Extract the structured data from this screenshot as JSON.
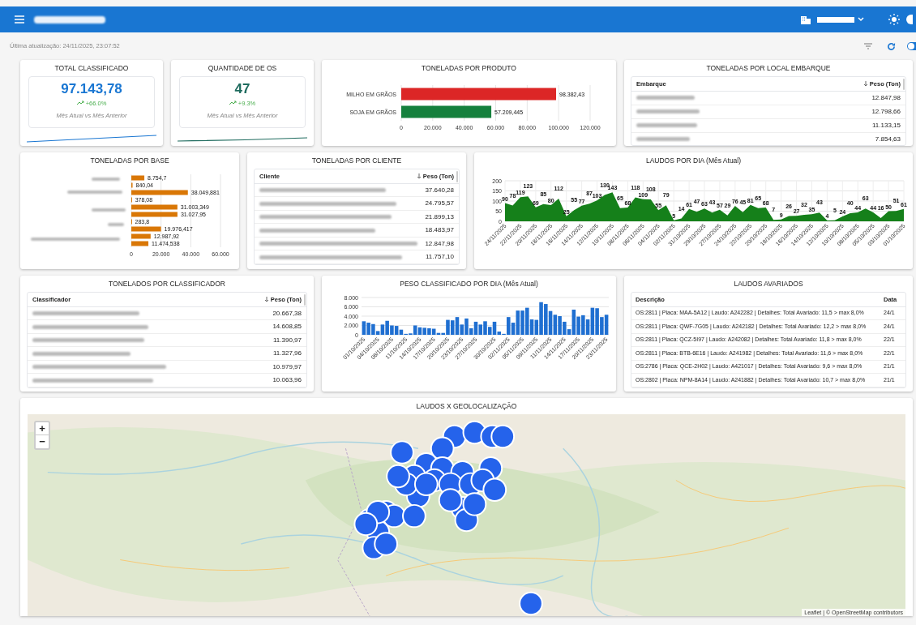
{
  "status": {
    "last_update": "Última atualização: 24/11/2025, 23:07:52",
    "auto_refresh_on": true
  },
  "kpis": [
    {
      "title": "TOTAL CLASSIFICADO",
      "value": "97.143,78",
      "change": "+66.0%",
      "caption": "Mês Atual vs Mês Anterior",
      "color": "#1976d2"
    },
    {
      "title": "QUANTIDADE DE OS",
      "value": "47",
      "change": "+9.3%",
      "caption": "Mês Atual vs Mês Anterior",
      "color": "#1e6b5e"
    }
  ],
  "produto": {
    "title": "TONELADAS POR PRODUTO",
    "chart_data": {
      "type": "bar",
      "orientation": "horizontal",
      "stacked": true,
      "grid": true,
      "categories": [
        "MILHO EM GRÃOS",
        "SOJA EM GRÃOS"
      ],
      "series": [
        {
          "color": "#dc2626",
          "values": [
            98382.43,
            null
          ]
        },
        {
          "color": "#15803d",
          "values": [
            null,
            57209.445
          ]
        }
      ],
      "value_labels": [
        "98.382,43",
        "57.209,445"
      ],
      "xlim": [
        0,
        120000
      ],
      "xticks": [
        {
          "value": 0,
          "label": "0"
        },
        {
          "value": 20000,
          "label": "20.000"
        },
        {
          "value": 40000,
          "label": "40.000"
        },
        {
          "value": 60000,
          "label": "60.000"
        },
        {
          "value": 80000,
          "label": "80.000"
        },
        {
          "value": 100000,
          "label": "100.000"
        },
        {
          "value": 120000,
          "label": "120.000"
        }
      ]
    }
  },
  "embarque": {
    "title": "TONELADAS POR LOCAL EMBARQUE",
    "columns": [
      "Embarque",
      "Peso (Ton)"
    ],
    "rows": [
      "12.847,98",
      "12.798,66",
      "11.133,15",
      "7.854,63"
    ]
  },
  "base": {
    "title": "TONELADAS POR BASE",
    "chart_data": {
      "type": "bar",
      "orientation": "horizontal",
      "grid": true,
      "series": [
        {
          "color": "#d97706",
          "values": [
            8754.7,
            840.04,
            38049.881,
            378.08,
            31003.349,
            31027.95,
            283.8,
            19976.417,
            12987.92,
            11474.538
          ]
        }
      ],
      "value_labels": [
        "8.754,7",
        "840,04",
        "38.049,881",
        "378,08",
        "31.003,349",
        "31.027,95",
        "283,8",
        "19.976,417",
        "12.987,92",
        "11.474,538"
      ],
      "xlim": [
        0,
        60000
      ],
      "xticks": [
        {
          "value": 0,
          "label": "0"
        },
        {
          "value": 20000,
          "label": "20.000"
        },
        {
          "value": 40000,
          "label": "40.000"
        },
        {
          "value": 60000,
          "label": "60.000"
        }
      ]
    }
  },
  "cliente": {
    "title": "TONELADAS POR CLIENTE",
    "columns": [
      "Cliente",
      "Peso (Ton)"
    ],
    "rows": [
      "37.640,28",
      "24.795,57",
      "21.899,13",
      "18.483,97",
      "12.847,98",
      "11.757,10"
    ]
  },
  "laudos_dia": {
    "title": "LAUDOS POR DIA (Mês Atual)",
    "chart_data": {
      "type": "area",
      "data_labels": true,
      "grid": true,
      "ylim": [
        0,
        200
      ],
      "yticks": [
        0,
        50,
        100,
        150,
        200
      ],
      "categories": [
        "24/11/2025",
        null,
        "22/11/2025",
        null,
        "20/11/2025",
        null,
        "18/11/2025",
        null,
        "16/11/2025",
        null,
        "14/11/2025",
        null,
        "12/11/2025",
        null,
        "10/11/2025",
        null,
        "08/11/2025",
        null,
        "06/11/2025",
        null,
        "04/11/2025",
        null,
        "02/11/2025",
        null,
        "31/10/2025",
        null,
        "29/10/2025",
        null,
        "27/10/2025",
        null,
        "24/10/2025",
        null,
        "22/10/2025",
        null,
        "20/10/2025",
        null,
        "18/10/2025",
        null,
        "16/10/2025",
        null,
        "14/10/2025",
        null,
        "12/10/2025",
        null,
        "10/10/2025",
        null,
        "08/10/2025",
        null,
        "05/10/2025",
        null,
        "03/10/2025",
        null,
        "01/10/2025"
      ],
      "series": [
        {
          "color": "#15801a",
          "values": [
            90,
            78,
            119,
            123,
            69,
            85,
            80,
            112,
            25,
            55,
            77,
            87,
            103,
            130,
            143,
            65,
            68,
            118,
            109,
            108,
            55,
            79,
            5,
            14,
            61,
            47,
            63,
            43,
            57,
            29,
            76,
            45,
            81,
            65,
            68,
            7,
            9,
            26,
            27,
            32,
            35,
            43,
            4,
            5,
            24,
            40,
            44,
            63,
            44,
            16,
            50,
            51,
            61
          ]
        }
      ]
    }
  },
  "classificador": {
    "title": "TONELADOS POR CLASSIFICADOR",
    "columns": [
      "Classificador",
      "Peso (Ton)"
    ],
    "rows": [
      "20.667,38",
      "14.608,85",
      "11.390,97",
      "11.327,96",
      "10.979,97",
      "10.063,96"
    ]
  },
  "peso_dia": {
    "title": "PESO CLASSIFICADO POR DIA (Mês Atual)",
    "chart_data": {
      "type": "bar",
      "grid": true,
      "ylim": [
        0,
        8000
      ],
      "yticks": [
        {
          "value": 0,
          "label": "0"
        },
        {
          "value": 2000,
          "label": "2.000"
        },
        {
          "value": 4000,
          "label": "4.000"
        },
        {
          "value": 6000,
          "label": "6.000"
        },
        {
          "value": 8000,
          "label": "8.000"
        }
      ],
      "categories": [
        "01/10/2025",
        null,
        null,
        "04/10/2025",
        null,
        null,
        "08/10/2025",
        null,
        null,
        "11/10/2025",
        null,
        null,
        "14/10/2025",
        null,
        null,
        "17/10/2025",
        null,
        null,
        "20/10/2025",
        null,
        null,
        "23/10/2025",
        null,
        null,
        "27/10/2025",
        null,
        null,
        null,
        "30/10/2025",
        null,
        null,
        "02/11/2025",
        null,
        null,
        "05/11/2025",
        null,
        null,
        "09/11/2025",
        null,
        null,
        "11/11/2025",
        null,
        null,
        "14/11/2025",
        null,
        null,
        "17/11/2025",
        null,
        null,
        "20/11/2025",
        null,
        null,
        "23/11/2025"
      ],
      "series": [
        {
          "color": "#1f6fd1",
          "values": [
            2900,
            2600,
            2300,
            800,
            2200,
            3000,
            2000,
            1900,
            1100,
            200,
            300,
            2000,
            1600,
            1500,
            1400,
            1300,
            400,
            400,
            3200,
            3100,
            3800,
            2200,
            3500,
            1400,
            2800,
            2200,
            2900,
            1700,
            2800,
            700,
            200,
            3800,
            2600,
            5200,
            5200,
            5800,
            3300,
            3200,
            7000,
            6600,
            5100,
            4300,
            4000,
            2800,
            1200,
            5400,
            3900,
            4200,
            3300,
            5800,
            5700,
            3800,
            4300
          ]
        }
      ]
    }
  },
  "avariados": {
    "title": "LAUDOS AVARIADOS",
    "columns": [
      "Descrição",
      "Data"
    ],
    "rows": [
      {
        "description": "OS:2811 | Placa: MAA-5A12 | Laudo: A242282 | Detalhes: Total Avariado: 11,5 > max 8,0%",
        "date": "24/1"
      },
      {
        "description": "OS:2811 | Placa: QWF-7G05 | Laudo: A242182 | Detalhes: Total Avariado: 12,2 > max 8,0%",
        "date": "24/1"
      },
      {
        "description": "OS:2811 | Placa: QCZ-5I97 | Laudo: A242082 | Detalhes: Total Avariado: 11,8 > max 8,0%",
        "date": "22/1"
      },
      {
        "description": "OS:2811 | Placa: BTB-6E16 | Laudo: A241982 | Detalhes: Total Avariado: 11,6 > max 8,0%",
        "date": "22/1"
      },
      {
        "description": "OS:2786 | Placa: QCE-2H02 | Laudo: A421017 | Detalhes: Total Avariado: 9,6 > max 8,0%",
        "date": "21/1"
      },
      {
        "description": "OS:2802 | Placa: NPM-8A14 | Laudo: A241882 | Detalhes: Total Avariado: 10,7 > max 8,0%",
        "date": "21/1"
      }
    ]
  },
  "map": {
    "title": "LAUDOS X GEOLOCALIZAÇÃO",
    "zoom_in": "+",
    "zoom_out": "−",
    "attribution": "Leaflet | © OpenStreetMap contributors"
  }
}
